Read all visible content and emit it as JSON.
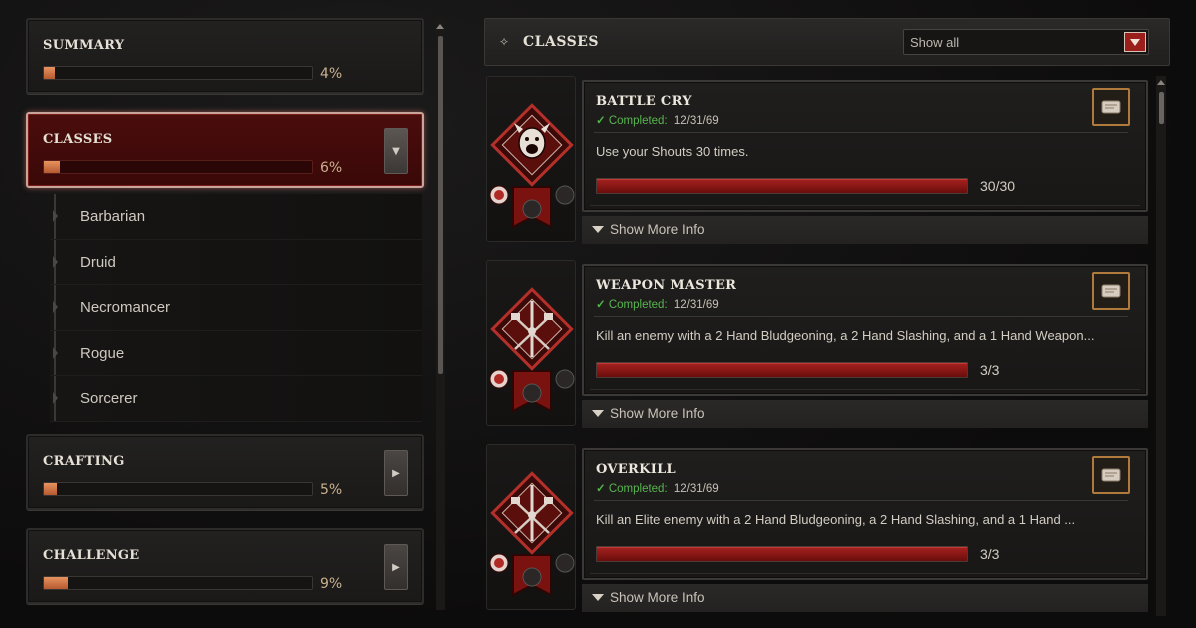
{
  "left_panel": {
    "categories": [
      {
        "title": "SUMMARY",
        "percent": "4%",
        "progress": 0.04,
        "has_arrow": false
      },
      {
        "title": "CLASSES",
        "percent": "6%",
        "progress": 0.06,
        "has_arrow": true,
        "active": true,
        "arrow_icon": "chevron-down-icon"
      },
      {
        "title": "CRAFTING",
        "percent": "5%",
        "progress": 0.05,
        "has_arrow": true,
        "arrow_icon": "chevron-right-icon"
      },
      {
        "title": "CHALLENGE",
        "percent": "9%",
        "progress": 0.09,
        "has_arrow": true,
        "arrow_icon": "chevron-right-icon"
      }
    ],
    "subcategories": [
      "Barbarian",
      "Druid",
      "Necromancer",
      "Rogue",
      "Sorcerer"
    ]
  },
  "right_panel": {
    "title": "CLASSES",
    "filter": {
      "value": "Show all"
    },
    "achievements": [
      {
        "title": "BATTLE CRY",
        "completed_label": "Completed:",
        "date": "12/31/69",
        "description": "Use your Shouts 30 times.",
        "progress": 1.0,
        "count": "30/30",
        "more_info": "Show More Info",
        "emblem": "shouting-barbarian-icon"
      },
      {
        "title": "WEAPON MASTER",
        "completed_label": "Completed:",
        "date": "12/31/69",
        "description": "Kill an enemy with a 2 Hand Bludgeoning, a 2 Hand Slashing, and a 1 Hand Weapon...",
        "progress": 1.0,
        "count": "3/3",
        "more_info": "Show More Info",
        "emblem": "crossed-weapons-icon"
      },
      {
        "title": "OVERKILL",
        "completed_label": "Completed:",
        "date": "12/31/69",
        "description": "Kill an Elite enemy with a 2 Hand Bludgeoning, a 2 Hand Slashing, and a 1 Hand ...",
        "progress": 1.0,
        "count": "3/3",
        "more_info": "Show More Info",
        "emblem": "crossed-weapons-icon"
      }
    ]
  },
  "colors": {
    "accent_red": "#9a1f1a",
    "progress_orange": "#e8935f",
    "completed_green": "#58b451",
    "reward_border": "#b07a3c"
  }
}
